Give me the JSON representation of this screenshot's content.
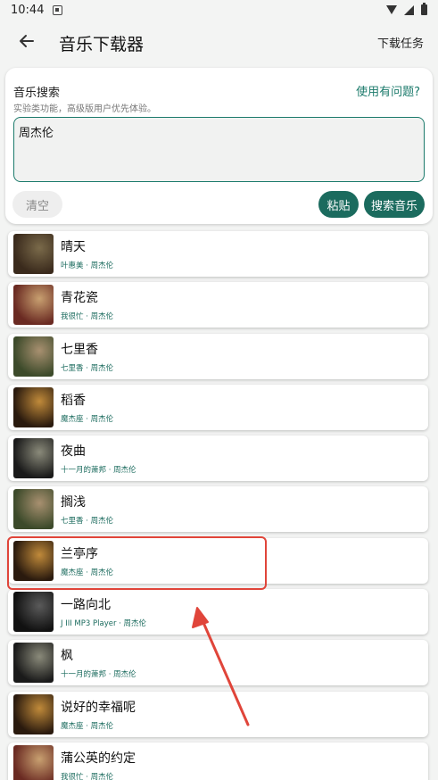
{
  "status_bar": {
    "time": "10:44"
  },
  "app_bar": {
    "title": "音乐下载器",
    "action": "下载任务"
  },
  "search": {
    "title": "音乐搜索",
    "help_link": "使用有问题?",
    "subtitle": "实验类功能，高级版用户优先体验。",
    "query": "周杰伦",
    "clear_label": "清空",
    "paste_label": "粘贴",
    "search_label": "搜索音乐"
  },
  "songs": [
    {
      "title": "晴天",
      "subtitle": "叶惠美 · 周杰伦",
      "cover_colors": [
        "#3a2a1c",
        "#7a6a4a"
      ]
    },
    {
      "title": "青花瓷",
      "subtitle": "我很忙 · 周杰伦",
      "cover_colors": [
        "#6a2a22",
        "#c8a070"
      ]
    },
    {
      "title": "七里香",
      "subtitle": "七里香 · 周杰伦",
      "cover_colors": [
        "#3c4a2a",
        "#a89070"
      ]
    },
    {
      "title": "稻香",
      "subtitle": "魔杰座 · 周杰伦",
      "cover_colors": [
        "#2a1a0e",
        "#c08a3a"
      ]
    },
    {
      "title": "夜曲",
      "subtitle": "十一月的萧邦 · 周杰伦",
      "cover_colors": [
        "#1a1a1a",
        "#8a8a7a"
      ]
    },
    {
      "title": "搁浅",
      "subtitle": "七里香 · 周杰伦",
      "cover_colors": [
        "#3c4a2a",
        "#a89070"
      ]
    },
    {
      "title": "兰亭序",
      "subtitle": "魔杰座 · 周杰伦",
      "cover_colors": [
        "#2a1a0e",
        "#c08a3a"
      ]
    },
    {
      "title": "一路向北",
      "subtitle": "J III MP3 Player · 周杰伦",
      "cover_colors": [
        "#111111",
        "#5a5a5a"
      ]
    },
    {
      "title": "枫",
      "subtitle": "十一月的萧邦 · 周杰伦",
      "cover_colors": [
        "#1a1a1a",
        "#8a8a7a"
      ]
    },
    {
      "title": "说好的幸福呢",
      "subtitle": "魔杰座 · 周杰伦",
      "cover_colors": [
        "#2a1a0e",
        "#c08a3a"
      ]
    },
    {
      "title": "蒲公英的约定",
      "subtitle": "我很忙 · 周杰伦",
      "cover_colors": [
        "#6a2a22",
        "#c8a070"
      ]
    }
  ],
  "annotation": {
    "highlighted_song": "兰亭序",
    "color": "#e0453a"
  },
  "colors": {
    "accent": "#1b6b5e",
    "link": "#1b7a6b",
    "background": "#f3f4f3"
  }
}
